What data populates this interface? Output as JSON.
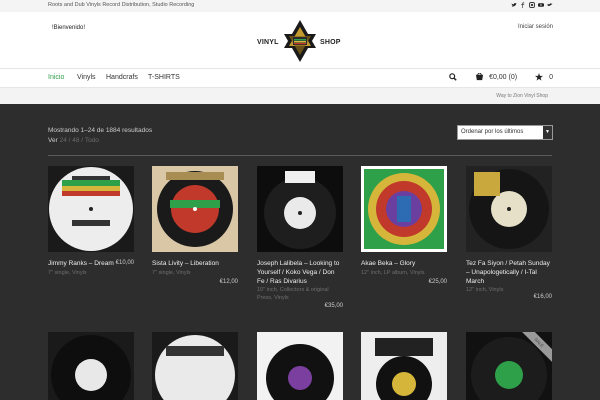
{
  "topbar": {
    "tagline": "Roots and Dub Vinyls Record Distribution, Studio Recording",
    "social_icons": [
      "twitter-icon",
      "facebook-icon",
      "instagram-icon",
      "youtube-icon",
      "bird-icon"
    ]
  },
  "header": {
    "welcome": "!Bienvenido!",
    "login": "Iniciar sesión",
    "logo_left": "VINYL",
    "logo_right": "SHOP"
  },
  "nav": {
    "items": [
      "Inicio",
      "Vinyls",
      "Handcrafs",
      "T-SHIRTS"
    ],
    "cart_label": "€0,00 (0)",
    "wishlist_count": "0"
  },
  "breadcrumb": "Way to Zion Vinyl Shop",
  "listing": {
    "results_text": "Mostrando 1–24 de 1884 resultados",
    "per_page_label": "Ver",
    "per_page_options": [
      "24",
      "48",
      "Todo"
    ],
    "sort_selected": "Ordenar por los últimos"
  },
  "products": [
    {
      "title": "Jimmy Ranks – Dream",
      "meta": "7\" single, Vinyls",
      "price": "€10,00"
    },
    {
      "title": "Sista Livity – Liberation",
      "meta": "7\" single, Vinyls",
      "price": "€12,00"
    },
    {
      "title": "Joseph Lalibela – Looking to Yourself / Koko Vega / Don Fe / Ras Divarius",
      "meta": "10\" inch, Collectors & original Press, Vinyls",
      "price": "€35,00"
    },
    {
      "title": "Akae Beka – Glory",
      "meta": "12\" inch, LP album, Vinyls",
      "price": "€25,00"
    },
    {
      "title": "Tez Fa Siyon / Petah Sunday – Unapologetically / I-Tal March",
      "meta": "12\" inch, Vinyls",
      "price": "€16,00"
    }
  ],
  "second_row_badge": "SALE",
  "colors": {
    "accent": "#2fa04a",
    "page_bg": "#2d2d2d"
  }
}
